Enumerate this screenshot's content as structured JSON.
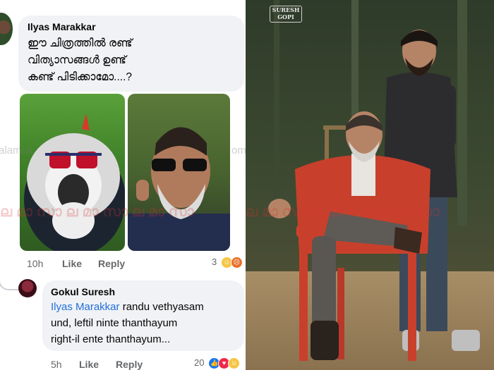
{
  "comment1": {
    "author": "Ilyas Marakkar",
    "lines": [
      "ഈ ചിത്രത്തിൽ രണ്ട്",
      "വിത്യാസങ്ങൾ ഉണ്ട്",
      "കണ്ട് പിടിക്കാമോ....?"
    ],
    "time": "10h",
    "like_label": "Like",
    "reply_label": "Reply",
    "reaction_count": "3"
  },
  "comment2": {
    "author": "Gokul Suresh",
    "mention": "Ilyas Marakkar",
    "line1_rest": " randu vethyasam",
    "line2": "und, leftil ninte thanthayum",
    "line3": "right-il ente thanthayum...",
    "time": "5h",
    "like_label": "Like",
    "reply_label": "Reply",
    "reaction_count": "20"
  },
  "watermark_text": "alamuk",
  "watermark_text2": "om",
  "right_logo": {
    "line1": "SURESH",
    "line2": "GOPI"
  },
  "colors": {
    "bubble": "#f0f2f5",
    "mention": "#216fdb",
    "meta": "#65676b",
    "jacket": "#c8402c"
  },
  "icons": [
    "laugh-emoji-icon",
    "angry-emoji-icon",
    "like-emoji-icon",
    "love-emoji-icon"
  ]
}
